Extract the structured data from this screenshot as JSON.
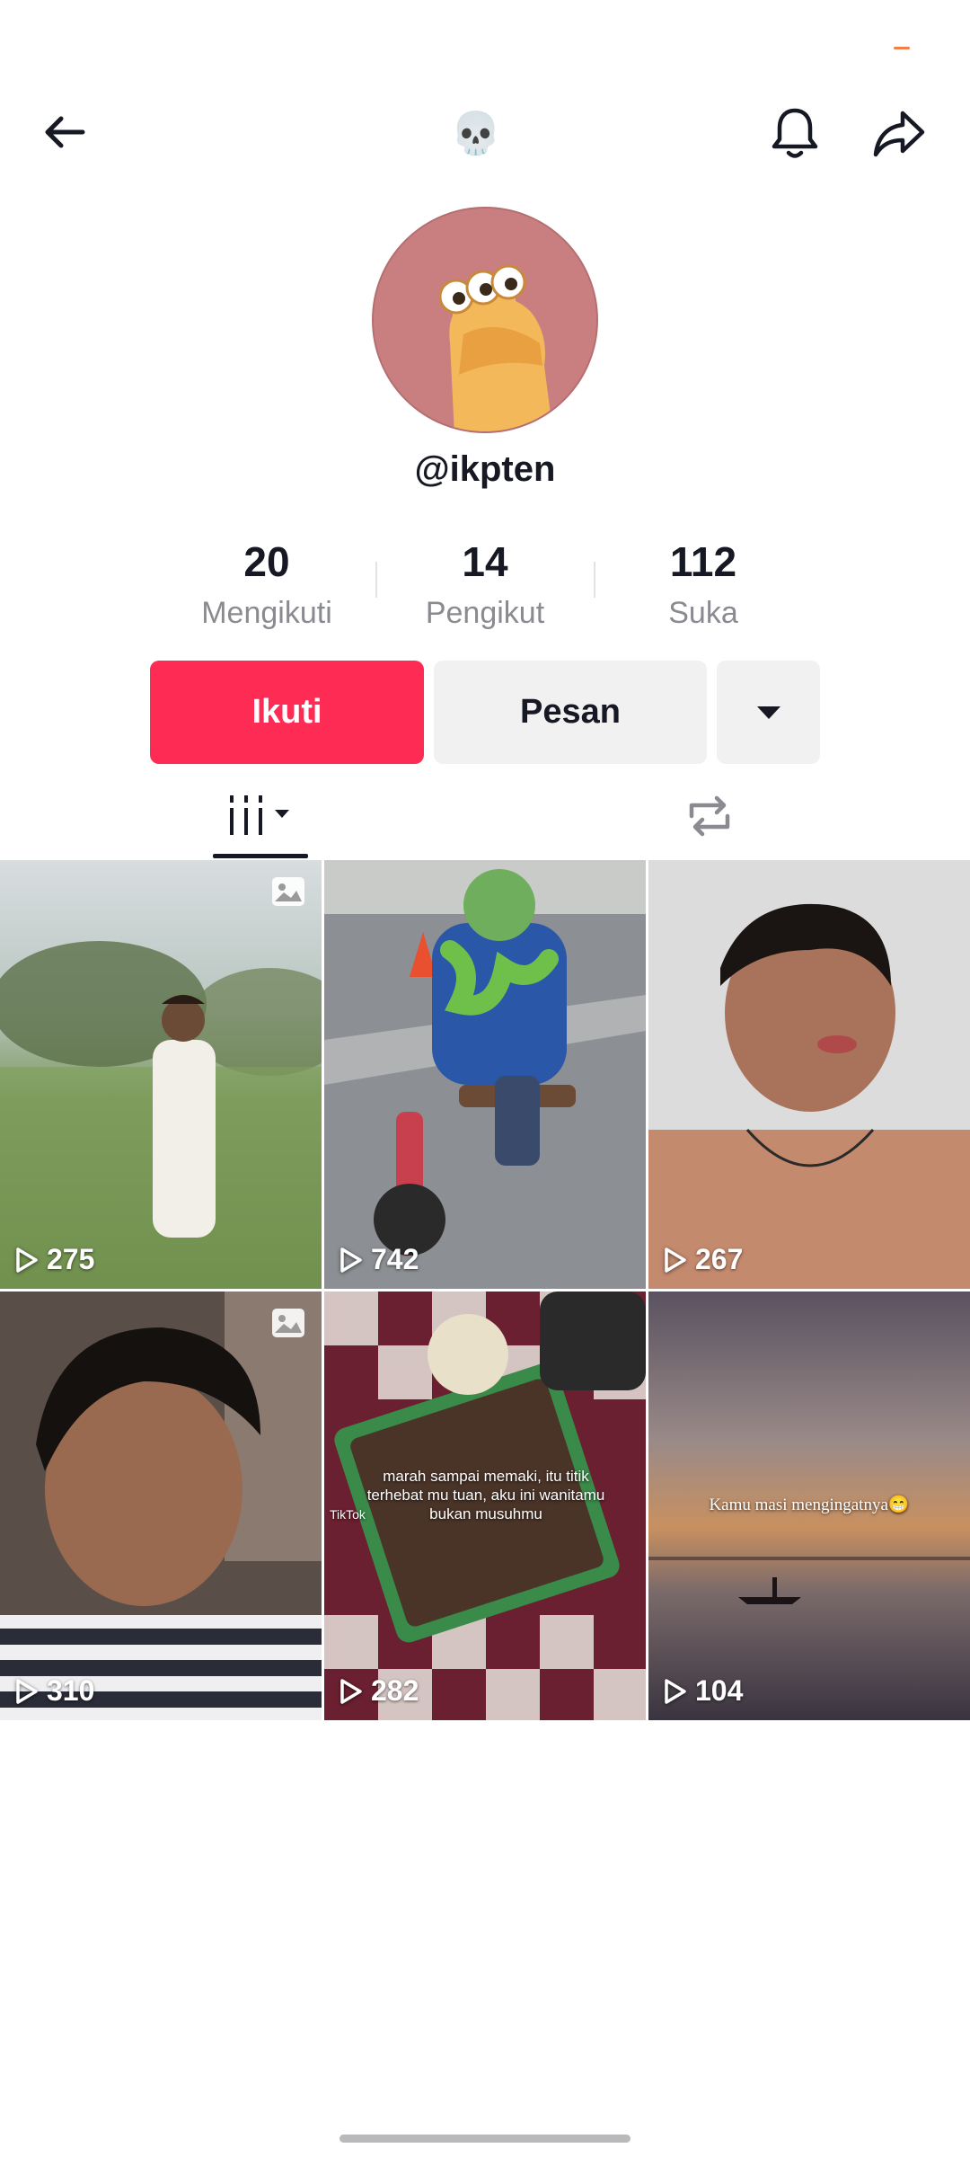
{
  "header": {
    "title_emoji": "💀",
    "back_icon": "arrow-left-icon",
    "bell_icon": "bell-icon",
    "share_icon": "share-arrow-icon"
  },
  "profile": {
    "username": "@ikpten",
    "avatar_color": "#c97f80"
  },
  "stats": [
    {
      "value": "20",
      "label": "Mengikuti"
    },
    {
      "value": "14",
      "label": "Pengikut"
    },
    {
      "value": "112",
      "label": "Suka"
    }
  ],
  "actions": {
    "follow_label": "Ikuti",
    "message_label": "Pesan",
    "more_icon": "caret-down-icon",
    "accent": "#fe2c55"
  },
  "tabs": {
    "videos_icon": "grid-icon",
    "reposts_icon": "repost-icon"
  },
  "videos": [
    {
      "views": "275",
      "photo": true,
      "overlay": ""
    },
    {
      "views": "742",
      "photo": false,
      "overlay": ""
    },
    {
      "views": "267",
      "photo": false,
      "overlay": ""
    },
    {
      "views": "310",
      "photo": true,
      "overlay": ""
    },
    {
      "views": "282",
      "photo": false,
      "overlay": "marah sampai memaki, itu titik terhebat mu tuan, aku ini wanitamu bukan musuhmu",
      "watermark": "TikTok"
    },
    {
      "views": "104",
      "photo": false,
      "overlay": "Kamu masi mengingatnya😁"
    }
  ]
}
